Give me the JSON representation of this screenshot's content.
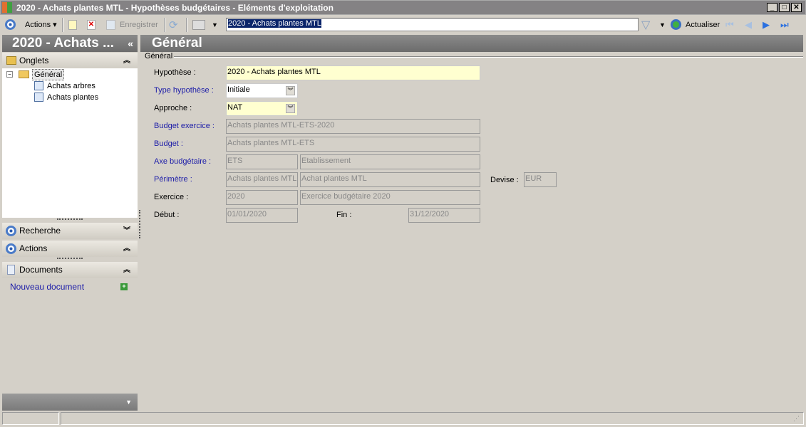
{
  "window": {
    "title": "2020 - Achats plantes MTL -  Hypothèses budgétaires - Eléments d'exploitation"
  },
  "toolbar": {
    "actions": "Actions",
    "save": "Enregistrer",
    "search_value": "2020 - Achats plantes MTL",
    "refresh": "Actualiser"
  },
  "left": {
    "header": "2020 - Achats ...",
    "onglets": "Onglets",
    "tree": {
      "root": "Général",
      "children": [
        "Achats arbres",
        "Achats plantes"
      ]
    },
    "recherche": "Recherche",
    "actions": "Actions",
    "documents": "Documents",
    "new_document": "Nouveau document"
  },
  "main": {
    "header": "Général",
    "group": "Général",
    "fields": {
      "hypothese": {
        "label": "Hypothèse :",
        "value": "2020 - Achats plantes MTL"
      },
      "type": {
        "label": "Type hypothèse :",
        "value": "Initiale"
      },
      "approche": {
        "label": "Approche  :",
        "value": "NAT"
      },
      "budget_exercice": {
        "label": "Budget exercice :",
        "value": "Achats plantes MTL-ETS-2020"
      },
      "budget": {
        "label": "Budget :",
        "value": "Achats plantes MTL-ETS"
      },
      "axe": {
        "label": "Axe budgétaire :",
        "code": "ETS",
        "value": "Etablissement"
      },
      "perimetre": {
        "label": "Périmètre :",
        "code": "Achats plantes MTL",
        "value": "Achat plantes MTL"
      },
      "devise": {
        "label": "Devise :",
        "value": "EUR"
      },
      "exercice": {
        "label": "Exercice :",
        "code": "2020",
        "value": "Exercice budgétaire 2020"
      },
      "debut": {
        "label": "Début :",
        "value": "01/01/2020"
      },
      "fin": {
        "label": "Fin :",
        "value": "31/12/2020"
      }
    }
  }
}
